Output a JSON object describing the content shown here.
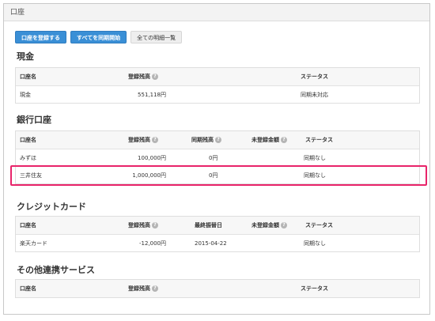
{
  "topbar": {
    "title": "口座"
  },
  "toolbar": {
    "register_label": "口座を登録する",
    "sync_all_label": "すべてを同期開始",
    "all_details_label": "全ての明細一覧"
  },
  "help_glyph": "?",
  "cash": {
    "title": "現金",
    "headers": {
      "name": "口座名",
      "registered_balance": "登録残高",
      "status": "ステータス"
    },
    "rows": [
      {
        "name": "現金",
        "registered_balance": "551,118円",
        "status": "同期未対応"
      }
    ]
  },
  "bank": {
    "title": "銀行口座",
    "headers": {
      "name": "口座名",
      "registered_balance": "登録残高",
      "synced_balance": "同期残高",
      "unregistered_amount": "未登録金額",
      "status": "ステータス"
    },
    "rows": [
      {
        "name": "みずほ",
        "registered_balance": "100,000円",
        "synced_balance": "0円",
        "status": "同期なし"
      },
      {
        "name": "三井住友",
        "registered_balance": "1,000,000円",
        "synced_balance": "0円",
        "status": "同期なし"
      }
    ]
  },
  "credit": {
    "title": "クレジットカード",
    "headers": {
      "name": "口座名",
      "registered_balance": "登録残高",
      "last_debit_date": "最終振替日",
      "unregistered_amount": "未登録金額",
      "status": "ステータス"
    },
    "rows": [
      {
        "name": "楽天カード",
        "registered_balance": "-12,000円",
        "last_debit_date": "2015-04-22",
        "status": "同期なし"
      }
    ]
  },
  "other": {
    "title": "その他連携サービス",
    "headers": {
      "name": "口座名",
      "registered_balance": "登録残高",
      "status": "ステータス"
    }
  },
  "highlight_color": "#e8246a"
}
